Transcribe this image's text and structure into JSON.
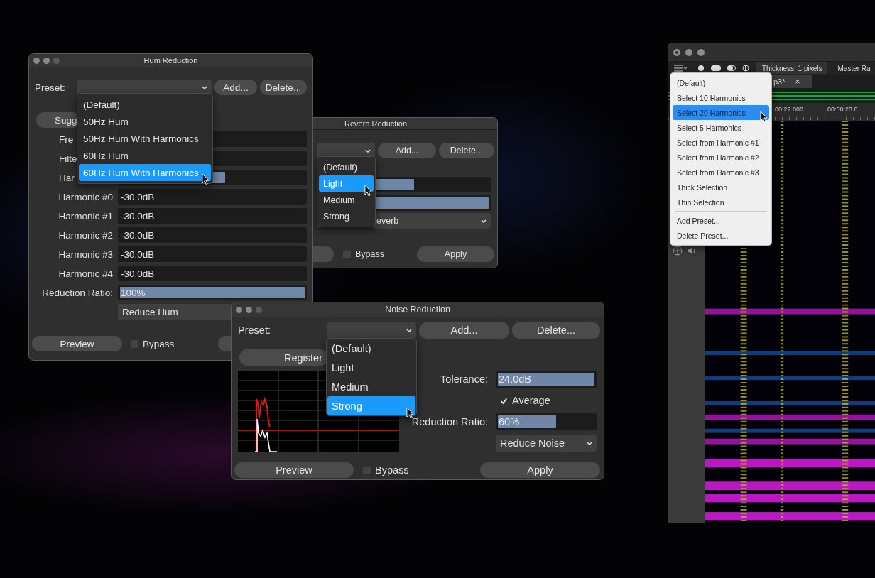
{
  "hum": {
    "title": "Hum Reduction",
    "preset_label": "Preset:",
    "add": "Add...",
    "delete": "Delete...",
    "menu": [
      {
        "label": "(Default)",
        "selected": false
      },
      {
        "label": "50Hz Hum",
        "selected": false
      },
      {
        "label": "50Hz Hum With Harmonics",
        "selected": false
      },
      {
        "label": "60Hz Hum",
        "selected": false
      },
      {
        "label": "60Hz Hum With Harmonics",
        "selected": true
      }
    ],
    "suggest_button": "Sugg",
    "partial_rows": [
      {
        "label": "Fre"
      },
      {
        "label": "Filte"
      },
      {
        "label": "Har",
        "level": 0.57
      }
    ],
    "harmonics": [
      {
        "label": "Harmonic #0",
        "value": "-30.0dB"
      },
      {
        "label": "Harmonic #1",
        "value": "-30.0dB"
      },
      {
        "label": "Harmonic #2",
        "value": "-30.0dB"
      },
      {
        "label": "Harmonic #3",
        "value": "-30.0dB"
      },
      {
        "label": "Harmonic #4",
        "value": "-30.0dB"
      }
    ],
    "ratio": {
      "label": "Reduction Ratio:",
      "value": "100%",
      "level": 1
    },
    "mode": "Reduce Hum",
    "preview": "Preview",
    "bypass": {
      "label": "Bypass",
      "checked": false
    }
  },
  "reverb": {
    "title": "Reverb Reduction",
    "add": "Add...",
    "delete": "Delete...",
    "menu": [
      {
        "label": "(Default)",
        "selected": false
      },
      {
        "label": "Light",
        "selected": true
      },
      {
        "label": "Medium",
        "selected": false
      },
      {
        "label": "Strong",
        "selected": false
      }
    ],
    "sliders": [
      {
        "level": 0.56
      },
      {
        "level": 1
      }
    ],
    "mode": "everb",
    "bypass": {
      "label": "Bypass",
      "checked": false
    },
    "apply": "Apply"
  },
  "noise": {
    "title": "Noise Reduction",
    "preset_label": "Preset:",
    "add": "Add...",
    "delete": "Delete...",
    "menu": [
      {
        "label": "(Default)",
        "selected": false
      },
      {
        "label": "Light",
        "selected": false
      },
      {
        "label": "Medium",
        "selected": false
      },
      {
        "label": "Strong",
        "selected": true
      }
    ],
    "register": "Register",
    "tolerance": {
      "label": "Tolerance:",
      "value": "24.0dB",
      "level": 1
    },
    "average": {
      "label": "Average",
      "checked": true
    },
    "ratio": {
      "label": "Reduction Ratio:",
      "value": "60%",
      "level": 0.6
    },
    "mode": "Reduce Noise",
    "preview": "Preview",
    "bypass": {
      "label": "Bypass",
      "checked": false
    },
    "apply": "Apply"
  },
  "editor": {
    "thickness": "Thickness: 1 pixels",
    "master": "Master Ra",
    "tab": {
      "label": "p3*",
      "close": "×"
    },
    "ruler": [
      "00:22.000",
      "00:00:23.0"
    ],
    "menu": {
      "groups": [
        {
          "items": [
            {
              "label": "(Default)",
              "selected": false
            },
            {
              "label": "Select 10 Harmonics",
              "selected": false
            },
            {
              "label": "Select 20 Harmonics",
              "selected": true
            },
            {
              "label": "Select 5 Harmonics",
              "selected": false
            },
            {
              "label": "Select from Harmonic #1",
              "selected": false
            },
            {
              "label": "Select from Harmonic #2",
              "selected": false
            },
            {
              "label": "Select from Harmonic #3",
              "selected": false
            },
            {
              "label": "Thick Selection",
              "selected": false
            },
            {
              "label": "Thin Selection",
              "selected": false
            }
          ]
        },
        {
          "items": [
            {
              "label": "Add Preset...",
              "selected": false
            },
            {
              "label": "Delete Preset...",
              "selected": false
            }
          ]
        }
      ]
    }
  }
}
